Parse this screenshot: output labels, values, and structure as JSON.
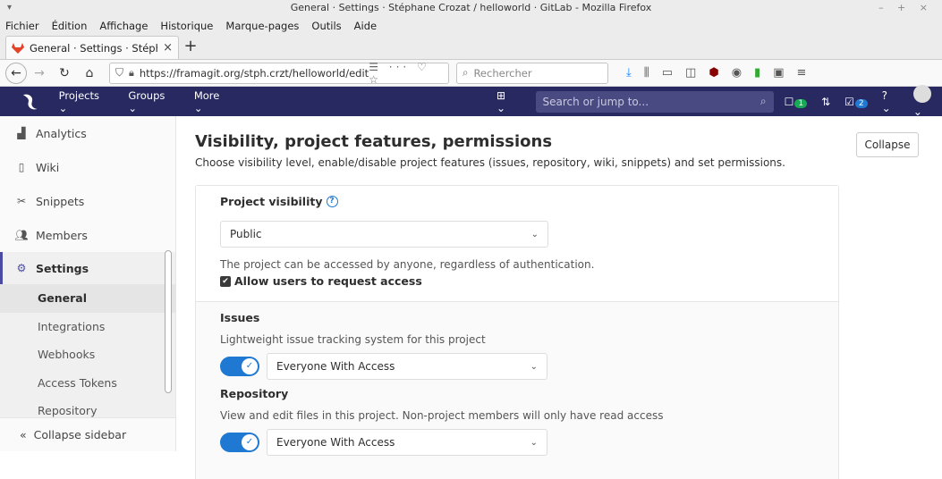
{
  "window": {
    "title": "General · Settings · Stéphane Crozat / helloworld · GitLab - Mozilla Firefox",
    "controls": "– + ×"
  },
  "menubar": [
    "Fichier",
    "Édition",
    "Affichage",
    "Historique",
    "Marque-pages",
    "Outils",
    "Aide"
  ],
  "tab": {
    "title": "General · Settings · Stéphane",
    "close": "×",
    "new": "+"
  },
  "nav": {
    "url": "https://framagit.org/stph.crzt/helloworld/edit",
    "url_icons": "☰ ··· ♡ ☆",
    "search_placeholder": "Rechercher"
  },
  "gitlab": {
    "nav": [
      "Projects ⌄",
      "Groups ⌄",
      "More ⌄"
    ],
    "search_placeholder": "Search or jump to...",
    "todo_count": "1",
    "mr_count": "2",
    "colors": {
      "header": "#292961",
      "accent": "#1f78d1",
      "green": "#1aaa55"
    }
  },
  "sidebar": {
    "items": [
      {
        "label": "Analytics",
        "icon": "analytics-icon"
      },
      {
        "label": "Wiki",
        "icon": "wiki-icon"
      },
      {
        "label": "Snippets",
        "icon": "snippets-icon"
      },
      {
        "label": "Members",
        "icon": "members-icon"
      },
      {
        "label": "Settings",
        "icon": "gear-icon"
      }
    ],
    "subitems": [
      "General",
      "Integrations",
      "Webhooks",
      "Access Tokens",
      "Repository"
    ],
    "collapse": "Collapse sidebar"
  },
  "section": {
    "title": "Visibility, project features, permissions",
    "description": "Choose visibility level, enable/disable project features (issues, repository, wiki, snippets) and set permissions.",
    "collapse": "Collapse"
  },
  "visibility": {
    "label": "Project visibility",
    "value": "Public",
    "help_text": "The project can be accessed by anyone, regardless of authentication.",
    "request_access_label": "Allow users to request access",
    "request_access_checked": true
  },
  "features": [
    {
      "name": "Issues",
      "description": "Lightweight issue tracking system for this project",
      "value": "Everyone With Access",
      "enabled": true
    },
    {
      "name": "Repository",
      "description": "View and edit files in this project. Non-project members will only have read access",
      "value": "Everyone With Access",
      "enabled": true
    }
  ]
}
